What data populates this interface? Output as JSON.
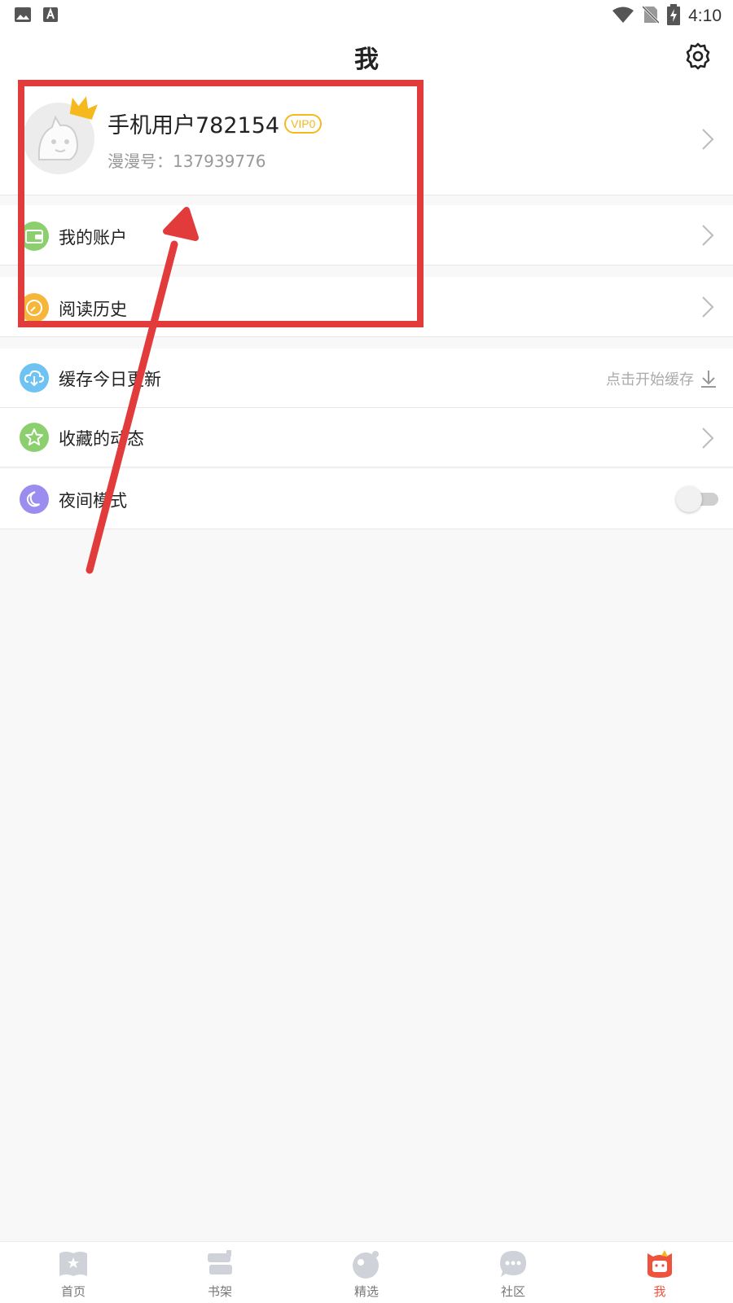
{
  "status_bar": {
    "time": "4:10",
    "left_icons": [
      "image-icon",
      "a-keyboard-icon"
    ],
    "right_icons": [
      "wifi-icon",
      "no-sim-icon",
      "battery-charging-icon"
    ]
  },
  "header": {
    "title": "我",
    "settings_icon": "gear-icon"
  },
  "profile": {
    "username": "手机用户782154",
    "vip_badge": "VIP0",
    "account_id": "漫漫号：137939776",
    "crown_color": "#f5b91d"
  },
  "menu": {
    "account": {
      "label": "我的账户",
      "icon": "wallet-icon",
      "color": "#8ccf6e"
    },
    "history": {
      "label": "阅读历史",
      "icon": "clock-icon",
      "color": "#f5b63a"
    },
    "cache": {
      "label": "缓存今日更新",
      "icon": "cloud-download-icon",
      "color": "#6ec3f2",
      "action": "点击开始缓存"
    },
    "favorites": {
      "label": "收藏的动态",
      "icon": "star-icon",
      "color": "#8ccf6e"
    },
    "night_mode": {
      "label": "夜间模式",
      "icon": "moon-icon",
      "color": "#9b8cf0",
      "enabled": false
    }
  },
  "annotation": {
    "color": "#e13b3b"
  },
  "bottom_nav": {
    "active_color": "#f0533b",
    "items": [
      {
        "label": "首页",
        "icon": "home-book-icon"
      },
      {
        "label": "书架",
        "icon": "bookshelf-icon"
      },
      {
        "label": "精选",
        "icon": "featured-icon"
      },
      {
        "label": "社区",
        "icon": "community-chat-icon"
      },
      {
        "label": "我",
        "icon": "profile-mascot-icon",
        "active": true
      }
    ]
  }
}
